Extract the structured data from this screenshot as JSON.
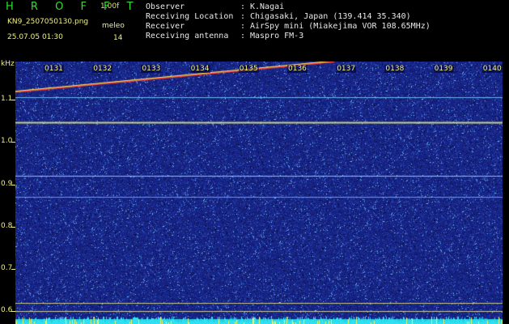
{
  "header": {
    "app_name": "H R O F F T",
    "version": "1.00f",
    "filename": "KN9_2507050130.png",
    "datetime": "25.07.05 01:30",
    "mode": "meleo",
    "count": "14",
    "fields": [
      {
        "label": "Observer",
        "value": "K.Nagai"
      },
      {
        "label": "Receiving Location",
        "value": "Chigasaki, Japan (139.414 35.340)"
      },
      {
        "label": "Receiver",
        "value": "AirSpy mini (Miakejima VOR 108.65MHz)"
      },
      {
        "label": "Receiving antenna",
        "value": "Maspro FM-3"
      }
    ],
    "separator": ":"
  },
  "colors": {
    "background": "#000000",
    "header_text": "#e8e8e8",
    "brand": "#33dd33",
    "annotation": "#f0f080",
    "spectrogram_base": "#1a2a8a"
  },
  "spectrogram": {
    "y_unit": "kHz",
    "x_ticks": [
      "0131",
      "0132",
      "0133",
      "0134",
      "0135",
      "0136",
      "0137",
      "0138",
      "0139",
      "0140"
    ],
    "y_ticks": [
      "1.1",
      "1.0",
      "0.9",
      "0.8",
      "0.7",
      "0.6"
    ],
    "y_range_khz": [
      0.57,
      1.19
    ],
    "x_range_min": [
      0,
      10
    ],
    "carrier_lines_khz": [
      1.105,
      1.046,
      0.92,
      0.87,
      0.62,
      0.6
    ],
    "meteor_trace": {
      "start": [
        0,
        1.118
      ],
      "end": [
        6.55,
        1.19
      ]
    }
  }
}
